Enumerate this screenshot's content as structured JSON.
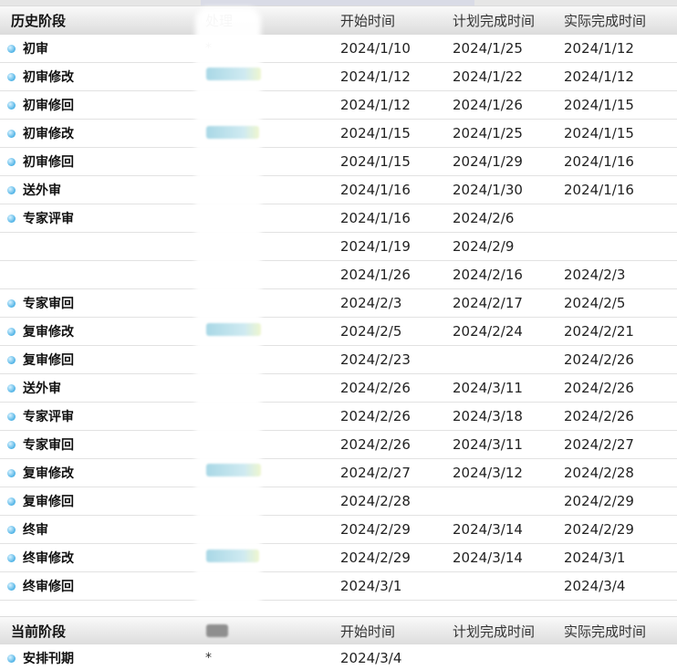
{
  "history": {
    "header": {
      "stage": "历史阶段",
      "handler": "处理",
      "start": "开始时间",
      "plan": "计划完成时间",
      "actual": "实际完成时间"
    },
    "rows": [
      {
        "stage": "初审",
        "handler": "*",
        "start": "2024/1/10",
        "plan": "2024/1/25",
        "actual": "2024/1/12"
      },
      {
        "stage": "初审修改",
        "handler": "",
        "start": "2024/1/12",
        "plan": "2024/1/22",
        "actual": "2024/1/12"
      },
      {
        "stage": "初审修回",
        "handler": "",
        "start": "2024/1/12",
        "plan": "2024/1/26",
        "actual": "2024/1/15"
      },
      {
        "stage": "初审修改",
        "handler": "",
        "start": "2024/1/15",
        "plan": "2024/1/25",
        "actual": "2024/1/15"
      },
      {
        "stage": "初审修回",
        "handler": "",
        "start": "2024/1/15",
        "plan": "2024/1/29",
        "actual": "2024/1/16"
      },
      {
        "stage": "送外审",
        "handler": "",
        "start": "2024/1/16",
        "plan": "2024/1/30",
        "actual": "2024/1/16"
      },
      {
        "stage": "专家评审",
        "handler": "",
        "start": "2024/1/16",
        "plan": "2024/2/6",
        "actual": ""
      },
      {
        "stage": "",
        "handler": "",
        "start": "2024/1/19",
        "plan": "2024/2/9",
        "actual": ""
      },
      {
        "stage": "",
        "handler": "",
        "start": "2024/1/26",
        "plan": "2024/2/16",
        "actual": "2024/2/3"
      },
      {
        "stage": "专家审回",
        "handler": "",
        "start": "2024/2/3",
        "plan": "2024/2/17",
        "actual": "2024/2/5"
      },
      {
        "stage": "复审修改",
        "handler": "",
        "start": "2024/2/5",
        "plan": "2024/2/24",
        "actual": "2024/2/21"
      },
      {
        "stage": "复审修回",
        "handler": "",
        "start": "2024/2/23",
        "plan": "",
        "actual": "2024/2/26"
      },
      {
        "stage": "送外审",
        "handler": "",
        "start": "2024/2/26",
        "plan": "2024/3/11",
        "actual": "2024/2/26"
      },
      {
        "stage": "专家评审",
        "handler": "",
        "start": "2024/2/26",
        "plan": "2024/3/18",
        "actual": "2024/2/26"
      },
      {
        "stage": "专家审回",
        "handler": "",
        "start": "2024/2/26",
        "plan": "2024/3/11",
        "actual": "2024/2/27"
      },
      {
        "stage": "复审修改",
        "handler": "",
        "start": "2024/2/27",
        "plan": "2024/3/12",
        "actual": "2024/2/28"
      },
      {
        "stage": "复审修回",
        "handler": "",
        "start": "2024/2/28",
        "plan": "",
        "actual": "2024/2/29"
      },
      {
        "stage": "终审",
        "handler": "",
        "start": "2024/2/29",
        "plan": "2024/3/14",
        "actual": "2024/2/29"
      },
      {
        "stage": "终审修改",
        "handler": "",
        "start": "2024/2/29",
        "plan": "2024/3/14",
        "actual": "2024/3/1"
      },
      {
        "stage": "终审修回",
        "handler": "",
        "start": "2024/3/1",
        "plan": "",
        "actual": "2024/3/4"
      }
    ]
  },
  "current": {
    "header": {
      "stage": "当前阶段",
      "start": "开始时间",
      "plan": "计划完成时间",
      "actual": "实际完成时间"
    },
    "rows": [
      {
        "stage": "安排刊期",
        "handler": "*",
        "start": "2024/3/4",
        "plan": "",
        "actual": ""
      }
    ]
  },
  "colors": {
    "bullet": "#4fb3e6",
    "header_bg": "#e9e9e9",
    "row_border": "#e2e2e2"
  },
  "icons": {
    "row_bullet": "stage-bullet-icon"
  }
}
